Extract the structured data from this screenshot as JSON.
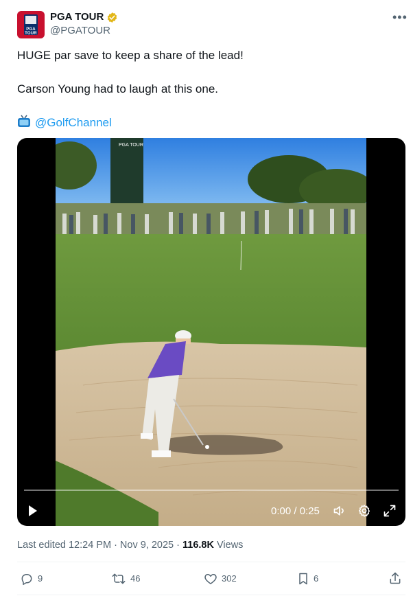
{
  "account": {
    "name": "PGA TOUR",
    "handle": "@PGATOUR",
    "verified": true,
    "avatar_text": "PGA TOUR",
    "brand_colors": {
      "red": "#c8102e",
      "blue": "#0b2f6b"
    }
  },
  "tweet": {
    "line1": "HUGE par save to keep a share of the lead!",
    "line2": "Carson Young had to laugh at this one.",
    "source_mention": "@GolfChannel",
    "tv_icon": "tv-icon"
  },
  "video": {
    "time_display": "0:00 / 0:25",
    "progress": 0,
    "scoreboard_text": "PGA TOUR"
  },
  "meta": {
    "edited_label": "Last edited 12:24 PM · Nov 9, 2025 · ",
    "views_count": "116.8K",
    "views_label": " Views"
  },
  "actions": {
    "replies": "9",
    "reposts": "46",
    "likes": "302",
    "bookmarks": "6"
  },
  "colors": {
    "accent": "#1d9bf0",
    "secondary_text": "#536471",
    "verified_gold": "#e2b719"
  }
}
